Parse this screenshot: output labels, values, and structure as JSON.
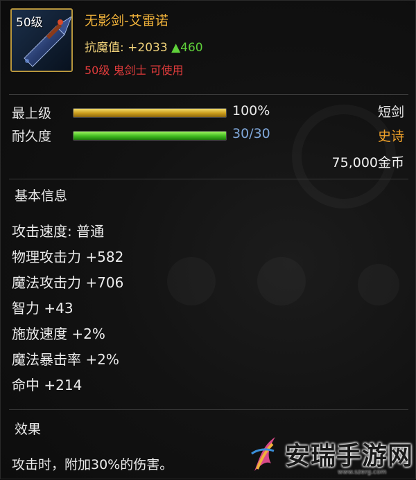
{
  "item": {
    "level_badge": "50级",
    "name": "无影剑-艾雷诺",
    "antimagic_label": "抗魔值:",
    "antimagic_value": "+2033",
    "antimagic_increase": "▲460",
    "requirement": "50级 鬼剑士 可使用"
  },
  "bars": {
    "grade": {
      "label": "最上级",
      "value_text": "100%",
      "fill_percent": 100,
      "color": "#e6c03a"
    },
    "durability": {
      "label": "耐久度",
      "value_text": "30/30",
      "fill_percent": 100,
      "color": "#4fd12a"
    }
  },
  "type_info": {
    "weapon_type": "短剑",
    "rarity": "史诗",
    "price": "75,000金币"
  },
  "basic_info": {
    "title": "基本信息",
    "stats": [
      "攻击速度: 普通",
      "物理攻击力 +582",
      "魔法攻击力 +706",
      "智力 +43",
      "施放速度 +2%",
      "魔法暴击率 +2%",
      "命中 +214"
    ]
  },
  "effect": {
    "title": "效果",
    "text": "攻击时，附加30%的伤害。"
  },
  "watermark": {
    "title": "安瑞手游网",
    "url": "www.szerg.com"
  },
  "colors": {
    "name": "#f0b23a",
    "requirement": "#e33c3c",
    "rarity": "#f0a22a",
    "increase": "#5fd13a",
    "icon_border": "#b8963c"
  }
}
